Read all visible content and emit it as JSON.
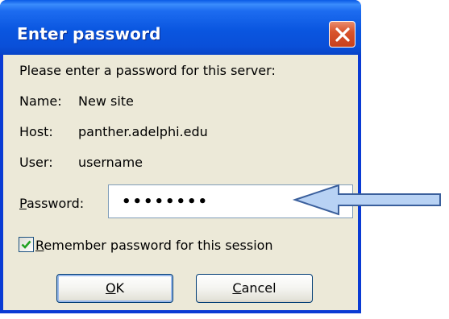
{
  "dialog": {
    "title": "Enter password",
    "prompt": "Please enter a password for this server:",
    "name_label": "Name:",
    "name_value": "New site",
    "host_label": "Host:",
    "host_value": "panther.adelphi.edu",
    "user_label": "User:",
    "user_value": "username",
    "password_label_first": "P",
    "password_label_rest": "assword:",
    "password_value": "••••••••",
    "remember_first": "R",
    "remember_rest": "emember password for this session",
    "remember_checked": true,
    "ok_first": "O",
    "ok_rest": "K",
    "cancel_first": "C",
    "cancel_rest": "ancel"
  },
  "colors": {
    "titlebar": "#0a56e0",
    "dialog_bg": "#ece9d8",
    "close_button": "#d9542c",
    "arrow_fill": "#b8d2f4",
    "arrow_stroke": "#3a5f9c",
    "checkmark": "#21a121"
  },
  "icons": {
    "close": "close-icon",
    "check": "checkmark-icon",
    "arrow": "left-arrow-icon"
  }
}
